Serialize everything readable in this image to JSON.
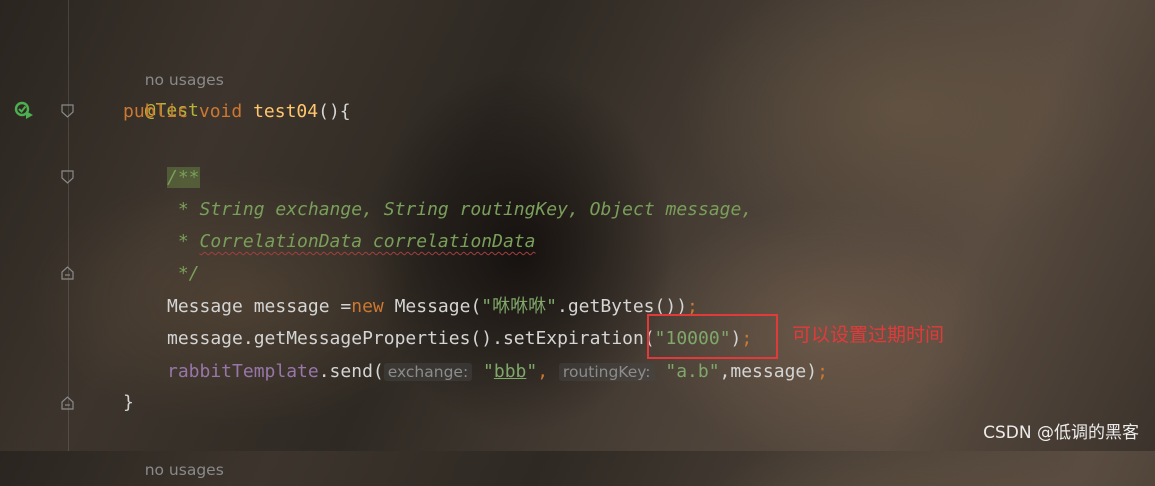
{
  "editor": {
    "hint_top": "no usages",
    "hint_bottom": "no usages",
    "annotation": "@Test",
    "kw_public": "public",
    "kw_void": "void",
    "method_name": "test04",
    "method_tail": "(){",
    "comment_open": "/**",
    "comment_line1": " * String exchange, String routingKey, Object message,",
    "comment_line2_prefix": " * ",
    "comment_line2_word": "CorrelationData correlationData",
    "comment_close": " */",
    "l1_a": "Message message =",
    "l1_new": "new",
    "l1_b": " Message(",
    "l1_str": "\"咻咻咻\"",
    "l1_c": ".getBytes())",
    "semicolon": ";",
    "l2_a": "message.getMessageProperties().setExpiration(",
    "l2_str": "\"10000\"",
    "l2_b": ")",
    "l3_field": "rabbitTemplate",
    "l3_a": ".send(",
    "l3_hint1": "exchange:",
    "l3_str1_q1": "\"",
    "l3_str1": "bbb",
    "l3_str1_q2": "\"",
    "comma": ",",
    "l3_hint2": "routingKey:",
    "l3_str2": "\"a.b\"",
    "l3_b": ",message)",
    "close_brace": "}"
  },
  "callout": {
    "text": "可以设置过期时间",
    "color": "#e23a3a"
  },
  "watermark": "CSDN @低调的黑客",
  "icons": [
    "run-test-icon",
    "fold-icon"
  ],
  "colors": {
    "keyword": "#cc7832",
    "method": "#ffc66d",
    "annotation": "#b5b33a",
    "comment": "#7a9f5a",
    "string": "#7fa86a",
    "field": "#9876aa"
  }
}
